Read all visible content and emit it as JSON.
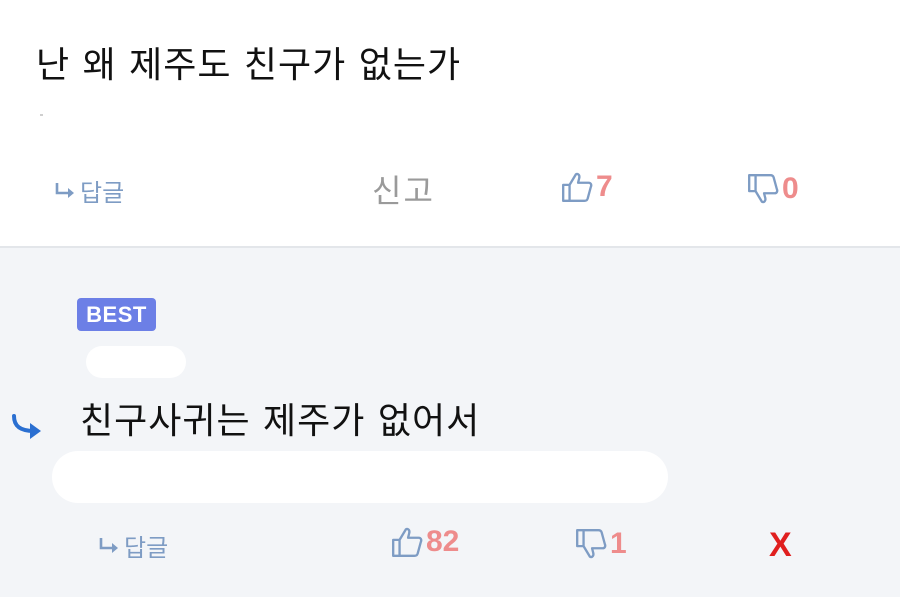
{
  "comment": {
    "text": "난 왜 제주도 친구가 없는가",
    "reply_label": "답글",
    "report_label": "신고",
    "like_count": "7",
    "dislike_count": "0"
  },
  "reply": {
    "badge": "BEST",
    "text": "친구사귀는 제주가 없어서",
    "reply_label": "답글",
    "like_count": "82",
    "dislike_count": "1",
    "delete_label": "X"
  },
  "colors": {
    "accent_blue": "#7e9cc4",
    "count_red": "#ee8c8c",
    "badge_bg": "#6c7fe6",
    "delete_red": "#e01f1f",
    "reply_bg": "#f3f5f8"
  },
  "icons": {
    "reply_link": "reply-arrow-icon",
    "like": "thumbs-up-icon",
    "dislike": "thumbs-down-icon",
    "reply_indicator": "reply-curved-arrow-icon"
  }
}
